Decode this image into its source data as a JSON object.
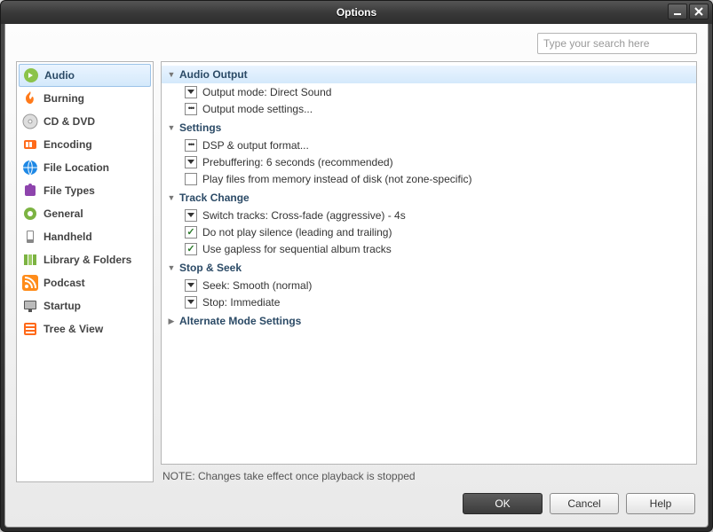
{
  "window": {
    "title": "Options"
  },
  "search": {
    "placeholder": "Type your search here"
  },
  "sidebar": {
    "items": [
      {
        "label": "Audio",
        "icon": "#8bc34a"
      },
      {
        "label": "Burning",
        "icon": "#ff7a1a"
      },
      {
        "label": "CD & DVD",
        "icon": "#b0b0b0"
      },
      {
        "label": "Encoding",
        "icon": "#ff6a1a"
      },
      {
        "label": "File Location",
        "icon": "#1e88e5"
      },
      {
        "label": "File Types",
        "icon": "#8e44ad"
      },
      {
        "label": "General",
        "icon": "#7cb342"
      },
      {
        "label": "Handheld",
        "icon": "#777"
      },
      {
        "label": "Library & Folders",
        "icon": "#7cb342"
      },
      {
        "label": "Podcast",
        "icon": "#ff8c1a"
      },
      {
        "label": "Startup",
        "icon": "#555"
      },
      {
        "label": "Tree & View",
        "icon": "#ff6a1a"
      }
    ]
  },
  "groups": {
    "audio_output": {
      "title": "Audio Output"
    },
    "settings": {
      "title": "Settings"
    },
    "track_change": {
      "title": "Track Change"
    },
    "stop_seek": {
      "title": "Stop & Seek"
    },
    "alt_mode": {
      "title": "Alternate Mode Settings"
    }
  },
  "options": {
    "output_mode": "Output mode: Direct Sound",
    "output_mode_settings": "Output mode settings...",
    "dsp": "DSP & output format...",
    "prebuffering": "Prebuffering: 6 seconds (recommended)",
    "play_memory": "Play files from memory instead of disk (not zone-specific)",
    "switch_tracks": "Switch tracks: Cross-fade (aggressive) - 4s",
    "no_silence": "Do not play silence (leading and trailing)",
    "gapless": "Use gapless for sequential album tracks",
    "seek": "Seek: Smooth (normal)",
    "stop": "Stop: Immediate"
  },
  "note": "NOTE: Changes take effect once playback is stopped",
  "buttons": {
    "ok": "OK",
    "cancel": "Cancel",
    "help": "Help"
  }
}
